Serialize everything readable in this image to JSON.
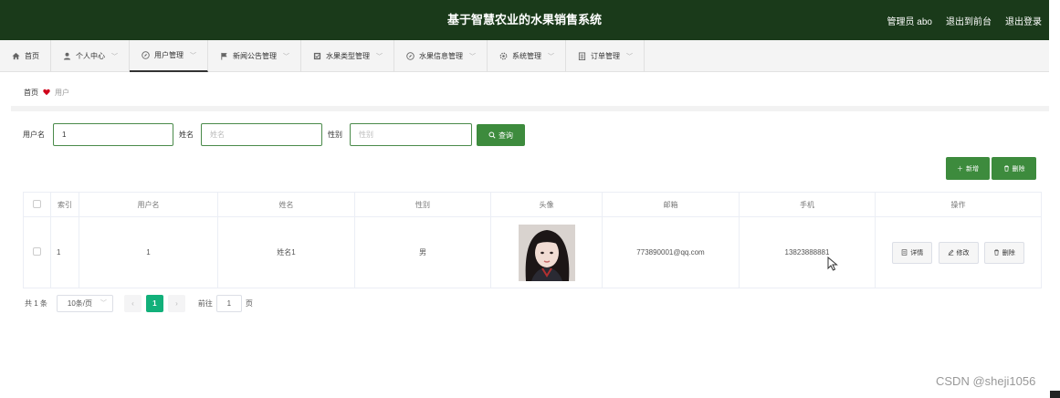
{
  "header": {
    "title": "基于智慧农业的水果销售系统",
    "admin": "管理员 abo",
    "to_front": "退出到前台",
    "logout": "退出登录"
  },
  "nav": [
    {
      "label": "首页",
      "icon": "home-icon",
      "caret": false
    },
    {
      "label": "个人中心",
      "icon": "user-icon",
      "caret": true
    },
    {
      "label": "用户管理",
      "icon": "compass-icon",
      "caret": true,
      "active": true
    },
    {
      "label": "新闻公告管理",
      "icon": "flag-icon",
      "caret": true
    },
    {
      "label": "水果类型管理",
      "icon": "square-icon",
      "caret": true
    },
    {
      "label": "水果信息管理",
      "icon": "compass-icon",
      "caret": true
    },
    {
      "label": "系统管理",
      "icon": "gear-icon",
      "caret": true
    },
    {
      "label": "订单管理",
      "icon": "list-icon",
      "caret": true
    }
  ],
  "breadcrumb": {
    "home": "首页",
    "current": "用户"
  },
  "search": {
    "username_label": "用户名",
    "username_value": "1",
    "name_label": "姓名",
    "name_placeholder": "姓名",
    "gender_label": "性别",
    "gender_placeholder": "性别",
    "query_label": "查询"
  },
  "actions": {
    "add": "新增",
    "delete": "删除"
  },
  "table": {
    "headers": [
      "",
      "索引",
      "用户名",
      "姓名",
      "性别",
      "头像",
      "邮箱",
      "手机",
      "操作"
    ],
    "rows": [
      {
        "index": "1",
        "username": "1",
        "name": "姓名1",
        "gender": "男",
        "email": "773890001@qq.com",
        "phone": "13823888881"
      }
    ],
    "row_actions": {
      "detail": "详情",
      "edit": "修改",
      "delete": "删除"
    }
  },
  "pager": {
    "total": "共 1 条",
    "page_size": "10条/页",
    "current": "1",
    "goto_label": "前往",
    "goto_value": "1",
    "page_unit": "页"
  },
  "watermark": "CSDN @sheji1056",
  "colors": {
    "header_bg": "#1a3a1a",
    "accent": "#3d8b3d",
    "pager_active": "#12b07a"
  }
}
